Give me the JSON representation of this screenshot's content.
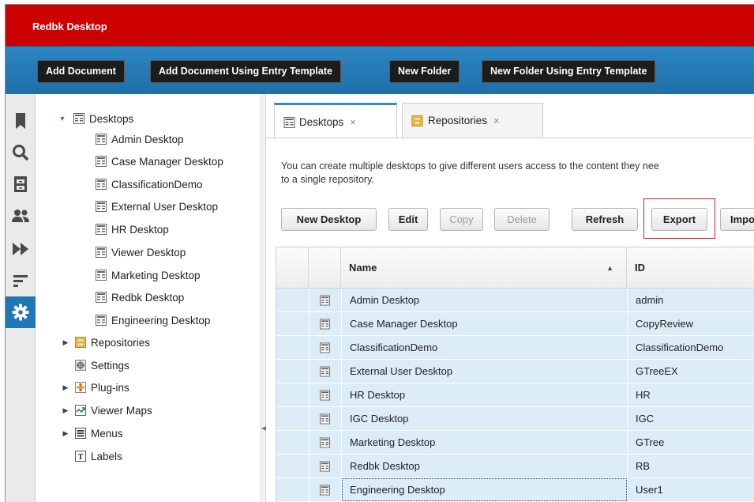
{
  "app": {
    "title": "Redbk Desktop"
  },
  "toolbar": {
    "buttons": [
      "Add Document",
      "Add Document Using Entry Template",
      "New Folder",
      "New Folder Using Entry Template"
    ]
  },
  "tree": {
    "root": "Desktops",
    "desktops": [
      "Admin Desktop",
      "Case Manager Desktop",
      "ClassificationDemo",
      "External User Desktop",
      "HR Desktop",
      "Viewer Desktop",
      "Marketing Desktop",
      "Redbk Desktop",
      "Engineering Desktop"
    ],
    "sections": [
      "Repositories",
      "Settings",
      "Plug-ins",
      "Viewer Maps",
      "Menus",
      "Labels"
    ]
  },
  "tabs": [
    {
      "label": "Desktops",
      "close": "×"
    },
    {
      "label": "Repositories",
      "close": "×"
    }
  ],
  "main": {
    "description": "You can create multiple desktops to give different users access to the content they nee to a single repository.",
    "description_line1": "You can create multiple desktops to give different users access to the content they nee",
    "description_line2": "to a single repository."
  },
  "actions": {
    "new_desktop": "New Desktop",
    "edit": "Edit",
    "copy": "Copy",
    "delete": "Delete",
    "refresh": "Refresh",
    "export": "Export",
    "import": "Impo"
  },
  "grid": {
    "columns": {
      "name": "Name",
      "id": "ID",
      "sort_indicator": "▲"
    },
    "rows": [
      {
        "name": "Admin Desktop",
        "id": "admin"
      },
      {
        "name": "Case Manager Desktop",
        "id": "CopyReview"
      },
      {
        "name": "ClassificationDemo",
        "id": "ClassificationDemo"
      },
      {
        "name": "External User Desktop",
        "id": "GTreeEX"
      },
      {
        "name": "HR Desktop",
        "id": "HR"
      },
      {
        "name": "IGC Desktop",
        "id": "IGC"
      },
      {
        "name": "Marketing Desktop",
        "id": "GTree"
      },
      {
        "name": "Redbk Desktop",
        "id": "RB"
      },
      {
        "name": "Engineering Desktop",
        "id": "User1"
      }
    ]
  },
  "colors": {
    "title_bar": "#cc0000",
    "toolbar": "#2c86c4",
    "active_rail": "#1f78b4",
    "row_bg": "#dcedf7",
    "highlight": "#cc2222"
  },
  "rail_icons": [
    "bookmark-icon",
    "search-icon",
    "cabinet-icon",
    "users-icon",
    "fast-forward-icon",
    "list-icon",
    "gear-icon"
  ]
}
